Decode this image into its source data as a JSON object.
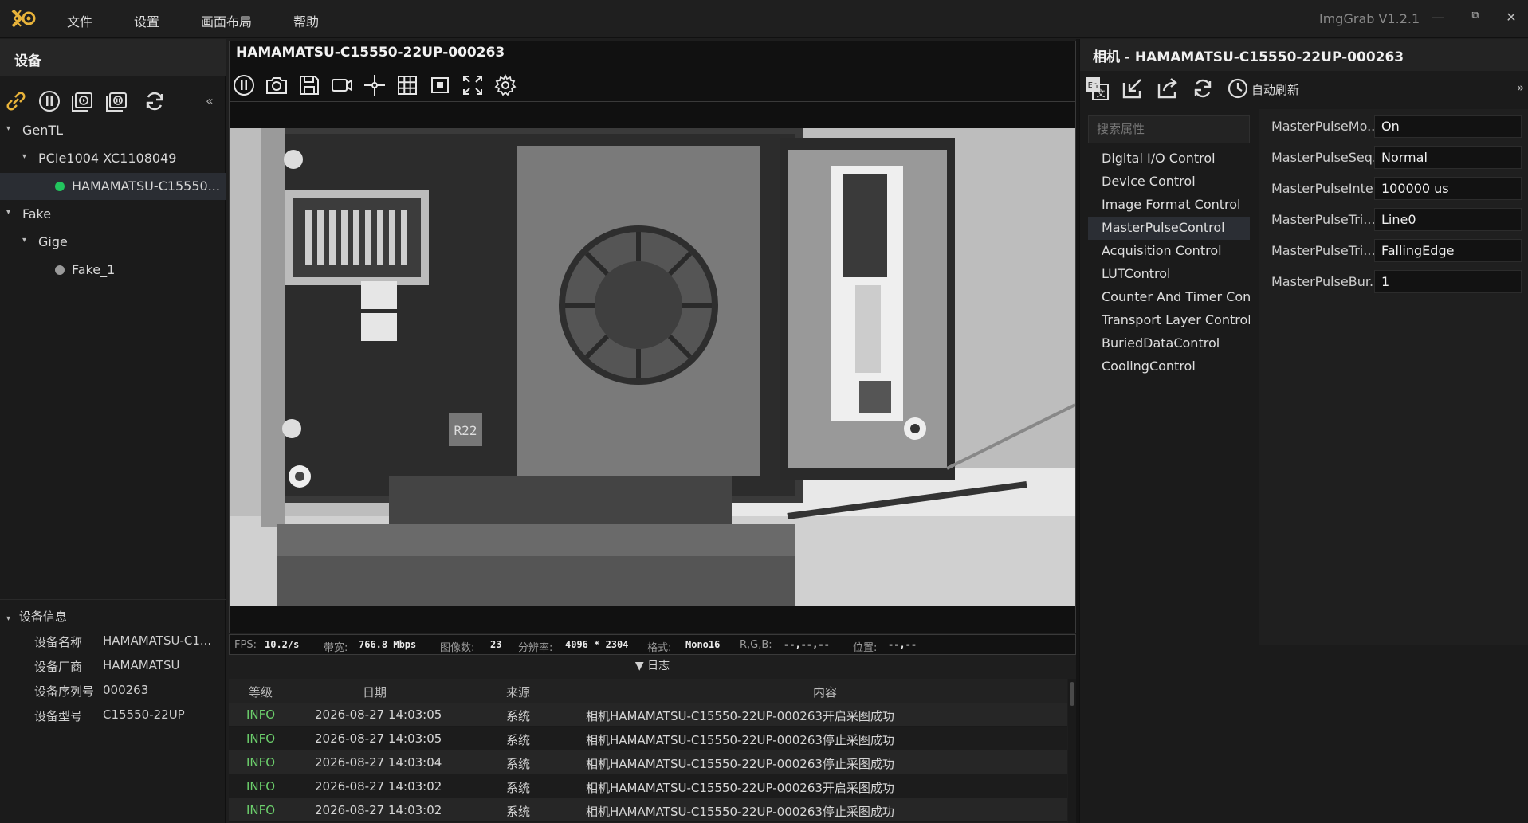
{
  "menubar": {
    "items": [
      "文件",
      "设置",
      "画面布局",
      "帮助"
    ],
    "app_title": "ImgGrab V1.2.1",
    "minimize": "—",
    "restore": "⧉",
    "close": "✕"
  },
  "left": {
    "header": "设备",
    "collapse": "«",
    "tree": [
      {
        "label": "GenTL",
        "arrow": "▾",
        "indent": 0
      },
      {
        "label": "PCIe1004 XC1108049",
        "arrow": "▾",
        "indent": 1
      },
      {
        "label": "HAMAMATSU-C15550...",
        "dot": "#22c55e",
        "indent": 2,
        "selected": true
      },
      {
        "label": "Fake",
        "arrow": "▾",
        "indent": 0
      },
      {
        "label": "Gige",
        "arrow": "▾",
        "indent": 1
      },
      {
        "label": "Fake_1",
        "dot": "#9a9a9a",
        "indent": 2
      }
    ],
    "info": {
      "title": "设备信息",
      "arrow": "▾",
      "rows": [
        {
          "k": "设备名称",
          "v": "HAMAMATSU-C1..."
        },
        {
          "k": "设备厂商",
          "v": "HAMAMATSU"
        },
        {
          "k": "设备序列号",
          "v": "000263"
        },
        {
          "k": "设备型号",
          "v": "C15550-22UP"
        }
      ]
    }
  },
  "viewer": {
    "title": "HAMAMATSU-C15550-22UP-000263",
    "image_alt_text": "R22",
    "status": {
      "fps_label": "FPS:",
      "fps": "10.2/s",
      "bw_label": "带宽:",
      "bw": "766.8 Mbps",
      "count_label": "图像数:",
      "count": "23",
      "res_label": "分辨率:",
      "res": "4096 * 2304",
      "fmt_label": "格式:",
      "fmt": "Mono16",
      "rgb_label": "R,G,B:",
      "rgb": "--,--,--",
      "pos_label": "位置:",
      "pos": "--,--"
    }
  },
  "log": {
    "toggle": "▼ 日志",
    "headers": {
      "level": "等级",
      "date": "日期",
      "source": "来源",
      "content": "内容"
    },
    "rows": [
      {
        "level": "INFO",
        "date": "2026-08-27 14:03:05",
        "source": "系统",
        "content": "相机HAMAMATSU-C15550-22UP-000263开启采图成功"
      },
      {
        "level": "INFO",
        "date": "2026-08-27 14:03:05",
        "source": "系统",
        "content": "相机HAMAMATSU-C15550-22UP-000263停止采图成功"
      },
      {
        "level": "INFO",
        "date": "2026-08-27 14:03:04",
        "source": "系统",
        "content": "相机HAMAMATSU-C15550-22UP-000263停止采图成功"
      },
      {
        "level": "INFO",
        "date": "2026-08-27 14:03:02",
        "source": "系统",
        "content": "相机HAMAMATSU-C15550-22UP-000263开启采图成功"
      },
      {
        "level": "INFO",
        "date": "2026-08-27 14:03:02",
        "source": "系统",
        "content": "相机HAMAMATSU-C15550-22UP-000263停止采图成功"
      }
    ]
  },
  "right": {
    "title": "相机 - HAMAMATSU-C15550-22UP-000263",
    "autorefresh": "自动刷新",
    "expand": "»",
    "search_placeholder": "搜索属性",
    "categories": [
      "Digital I/O Control",
      "Device Control",
      "Image Format Control",
      "MasterPulseControl",
      "Acquisition Control",
      "LUTControl",
      "Counter And Timer Control",
      "Transport Layer Control",
      "BuriedDataControl",
      "CoolingControl"
    ],
    "selected_category": 3,
    "properties": [
      {
        "k": "MasterPulseMo...",
        "v": "On"
      },
      {
        "k": "MasterPulseSeq...",
        "v": "Normal"
      },
      {
        "k": "MasterPulseInte...",
        "v": "100000 us"
      },
      {
        "k": "MasterPulseTri...",
        "v": "Line0"
      },
      {
        "k": "MasterPulseTri...",
        "v": "FallingEdge"
      },
      {
        "k": "MasterPulseBur...",
        "v": "1"
      }
    ]
  },
  "colors": {
    "accent": "#e8b33a",
    "ok": "#22c55e",
    "info": "#6ccf6c"
  }
}
